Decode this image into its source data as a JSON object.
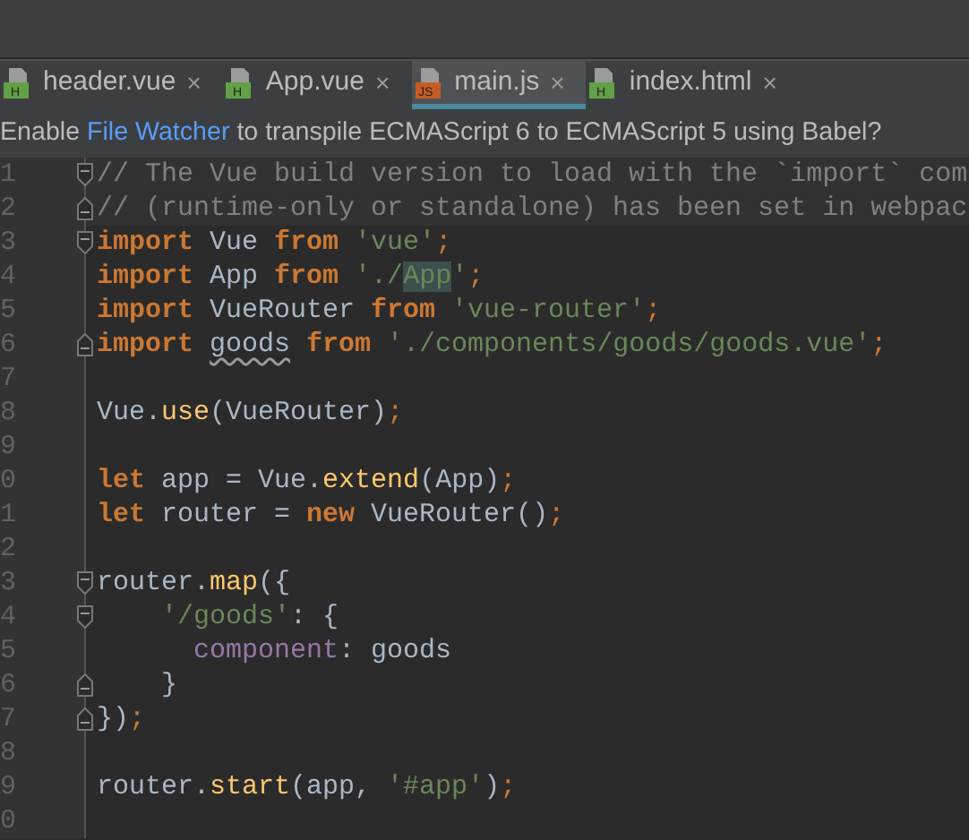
{
  "tabs": [
    {
      "label": "header.vue",
      "icon_text": "H",
      "color": "#62a145",
      "close": "×",
      "selected": false
    },
    {
      "label": "App.vue",
      "icon_text": "H",
      "color": "#62a145",
      "close": "×",
      "selected": false
    },
    {
      "label": "main.js",
      "icon_text": "JS",
      "color": "#c75c26",
      "close": "×",
      "selected": true
    },
    {
      "label": "index.html",
      "icon_text": "H",
      "color": "#62a145",
      "close": "×",
      "selected": false
    }
  ],
  "notification": {
    "before": "Enable ",
    "link": "File Watcher",
    "after": " to transpile ECMAScript 6 to ECMAScript 5 using Babel?"
  },
  "code_lines": [
    {
      "number": "1",
      "fold_start": true,
      "shaded": true,
      "tokens": [
        {
          "text": "// The Vue build version to load with the `import` com",
          "kind": "comment"
        }
      ]
    },
    {
      "number": "2",
      "fold_end": true,
      "shaded": true,
      "tokens": [
        {
          "text": "// (runtime-only or standalone) has been set in webpac",
          "kind": "comment"
        }
      ]
    },
    {
      "number": "3",
      "fold_start": true,
      "tokens": [
        {
          "text": "import ",
          "kind": "keyword"
        },
        {
          "text": "Vue ",
          "kind": "plain"
        },
        {
          "text": "from ",
          "kind": "keyword"
        },
        {
          "text": "'vue'",
          "kind": "string"
        },
        {
          "text": ";",
          "kind": "semicolon"
        }
      ]
    },
    {
      "number": "4",
      "tokens": [
        {
          "text": "import ",
          "kind": "keyword"
        },
        {
          "text": "App ",
          "kind": "plain"
        },
        {
          "text": "from ",
          "kind": "keyword"
        },
        {
          "text": "'./",
          "kind": "string"
        },
        {
          "text": "App",
          "kind": "string",
          "highlighted": true
        },
        {
          "text": "'",
          "kind": "string"
        },
        {
          "text": ";",
          "kind": "semicolon"
        }
      ]
    },
    {
      "number": "5",
      "tokens": [
        {
          "text": "import ",
          "kind": "keyword"
        },
        {
          "text": "VueRouter ",
          "kind": "plain"
        },
        {
          "text": "from ",
          "kind": "keyword"
        },
        {
          "text": "'vue-router'",
          "kind": "string"
        },
        {
          "text": ";",
          "kind": "semicolon"
        }
      ]
    },
    {
      "number": "6",
      "fold_end": true,
      "tokens": [
        {
          "text": "import ",
          "kind": "keyword"
        },
        {
          "text": "goods",
          "kind": "plain",
          "warning": true
        },
        {
          "text": " from ",
          "kind": "keyword"
        },
        {
          "text": "'./components/goods/goods.vue'",
          "kind": "string"
        },
        {
          "text": ";",
          "kind": "semicolon"
        }
      ]
    },
    {
      "number": "7"
    },
    {
      "number": "8",
      "tokens": [
        {
          "text": "Vue.",
          "kind": "plain"
        },
        {
          "text": "use",
          "kind": "method"
        },
        {
          "text": "(VueRouter)",
          "kind": "plain"
        },
        {
          "text": ";",
          "kind": "semicolon"
        }
      ]
    },
    {
      "number": "9"
    },
    {
      "number": "0",
      "tokens": [
        {
          "text": "let",
          "kind": "keyword"
        },
        {
          "text": " app = Vue.",
          "kind": "plain"
        },
        {
          "text": "extend",
          "kind": "method"
        },
        {
          "text": "(App)",
          "kind": "plain"
        },
        {
          "text": ";",
          "kind": "semicolon"
        }
      ]
    },
    {
      "number": "1",
      "tokens": [
        {
          "text": "let",
          "kind": "keyword"
        },
        {
          "text": " router = ",
          "kind": "plain"
        },
        {
          "text": "new",
          "kind": "keyword"
        },
        {
          "text": " VueRouter()",
          "kind": "plain"
        },
        {
          "text": ";",
          "kind": "semicolon"
        }
      ]
    },
    {
      "number": "2"
    },
    {
      "number": "3",
      "fold_start": true,
      "tokens": [
        {
          "text": "router.",
          "kind": "plain"
        },
        {
          "text": "map",
          "kind": "method"
        },
        {
          "text": "({",
          "kind": "plain"
        }
      ]
    },
    {
      "number": "4",
      "fold_start": true,
      "tokens": [
        {
          "text": "    '/goods'",
          "kind": "string"
        },
        {
          "text": ": {",
          "kind": "plain"
        }
      ]
    },
    {
      "number": "5",
      "tokens": [
        {
          "text": "      component",
          "kind": "property"
        },
        {
          "text": ": goods",
          "kind": "plain"
        }
      ]
    },
    {
      "number": "6",
      "fold_end": true,
      "tokens": [
        {
          "text": "    }",
          "kind": "plain"
        }
      ]
    },
    {
      "number": "7",
      "fold_end": true,
      "tokens": [
        {
          "text": "})",
          "kind": "plain"
        },
        {
          "text": ";",
          "kind": "semicolon"
        }
      ]
    },
    {
      "number": "8"
    },
    {
      "number": "9",
      "tokens": [
        {
          "text": "router.",
          "kind": "plain"
        },
        {
          "text": "start",
          "kind": "method"
        },
        {
          "text": "(app, ",
          "kind": "plain"
        },
        {
          "text": "'#app'",
          "kind": "string"
        },
        {
          "text": ")",
          "kind": "plain"
        },
        {
          "text": ";",
          "kind": "semicolon"
        }
      ]
    },
    {
      "number": "0"
    }
  ]
}
